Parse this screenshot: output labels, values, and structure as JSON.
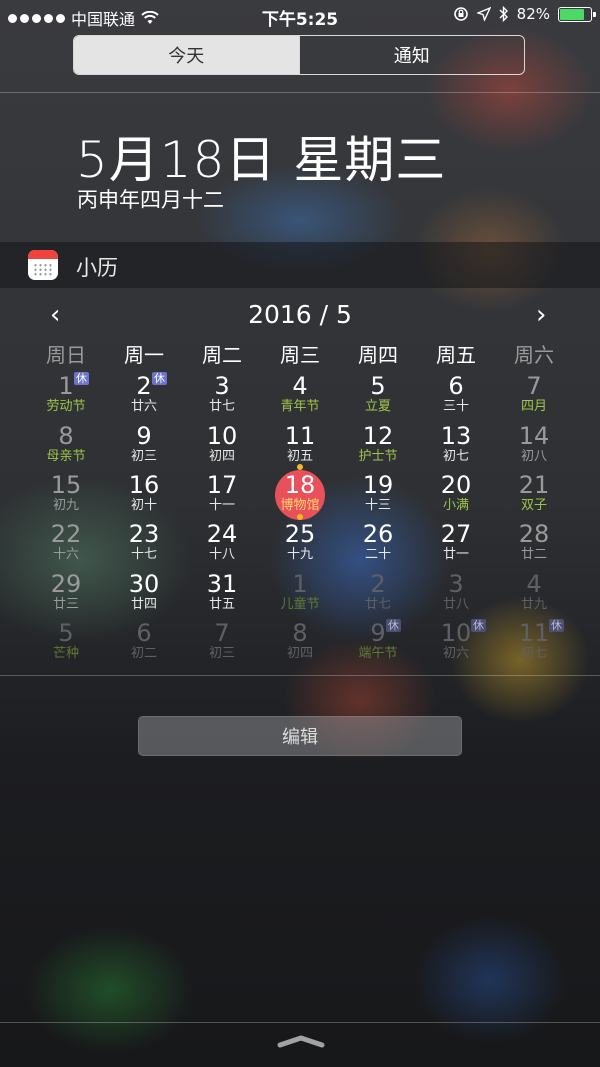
{
  "status_bar": {
    "carrier": "中国联通",
    "time": "下午5:25",
    "battery": "82%",
    "battery_level": 0.82,
    "icons": [
      "signal-dots-icon",
      "wifi-icon",
      "rotation-lock-icon",
      "location-arrow-icon",
      "bluetooth-icon",
      "battery-icon"
    ]
  },
  "tabs": {
    "today": "今天",
    "notifications": "通知"
  },
  "header": {
    "date": "5月18日 星期三",
    "lunar": "丙申年四月十二"
  },
  "widget": {
    "title": "小历",
    "icon": "calendar-app-icon"
  },
  "calendar": {
    "prev": "‹",
    "next": "›",
    "title": "2016 / 5",
    "weekdays": [
      "周日",
      "周一",
      "周二",
      "周三",
      "周四",
      "周五",
      "周六"
    ],
    "weeks": [
      [
        {
          "d": "1",
          "s": "劳动节",
          "badge": "休"
        },
        {
          "d": "2",
          "s": "廿六",
          "badge": "休"
        },
        {
          "d": "3",
          "s": "廿七"
        },
        {
          "d": "4",
          "s": "青年节"
        },
        {
          "d": "5",
          "s": "立夏"
        },
        {
          "d": "6",
          "s": "三十"
        },
        {
          "d": "7",
          "s": "四月"
        }
      ],
      [
        {
          "d": "8",
          "s": "母亲节"
        },
        {
          "d": "9",
          "s": "初三"
        },
        {
          "d": "10",
          "s": "初四"
        },
        {
          "d": "11",
          "s": "初五"
        },
        {
          "d": "12",
          "s": "护士节"
        },
        {
          "d": "13",
          "s": "初七"
        },
        {
          "d": "14",
          "s": "初八"
        }
      ],
      [
        {
          "d": "15",
          "s": "初九"
        },
        {
          "d": "16",
          "s": "初十"
        },
        {
          "d": "17",
          "s": "十一"
        },
        {
          "d": "18",
          "s": "博物馆"
        },
        {
          "d": "19",
          "s": "十三"
        },
        {
          "d": "20",
          "s": "小满"
        },
        {
          "d": "21",
          "s": "双子"
        }
      ],
      [
        {
          "d": "22",
          "s": "十六"
        },
        {
          "d": "23",
          "s": "十七"
        },
        {
          "d": "24",
          "s": "十八"
        },
        {
          "d": "25",
          "s": "十九"
        },
        {
          "d": "26",
          "s": "二十"
        },
        {
          "d": "27",
          "s": "廿一"
        },
        {
          "d": "28",
          "s": "廿二"
        }
      ],
      [
        {
          "d": "29",
          "s": "廿三"
        },
        {
          "d": "30",
          "s": "廿四"
        },
        {
          "d": "31",
          "s": "廿五"
        },
        {
          "d": "1",
          "s": "儿童节"
        },
        {
          "d": "2",
          "s": "廿七"
        },
        {
          "d": "3",
          "s": "廿八"
        },
        {
          "d": "4",
          "s": "廿九"
        }
      ],
      [
        {
          "d": "5",
          "s": "芒种"
        },
        {
          "d": "6",
          "s": "初二"
        },
        {
          "d": "7",
          "s": "初三"
        },
        {
          "d": "8",
          "s": "初四"
        },
        {
          "d": "9",
          "s": "端午节",
          "badge": "休"
        },
        {
          "d": "10",
          "s": "初六",
          "badge": "休"
        },
        {
          "d": "11",
          "s": "初七",
          "badge": "休"
        }
      ]
    ]
  },
  "edit_button": "编辑",
  "grabber_icon": "pull-up-chevron-icon"
}
